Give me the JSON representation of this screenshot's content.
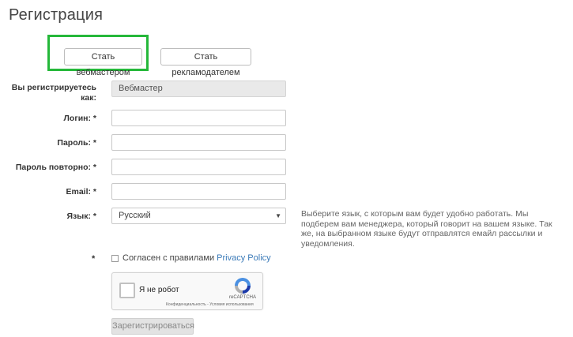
{
  "page": {
    "title": "Регистрация"
  },
  "role_buttons": {
    "webmaster": "Стать вебмастером",
    "advertiser": "Стать рекламодателем"
  },
  "form": {
    "role": {
      "label": "Вы регистрируетесь как:",
      "value": "Вебмастер"
    },
    "login": {
      "label": "Логин: *",
      "value": ""
    },
    "password": {
      "label": "Пароль: *",
      "value": ""
    },
    "password_repeat": {
      "label": "Пароль повторно: *",
      "value": ""
    },
    "email": {
      "label": "Email: *",
      "value": ""
    },
    "language": {
      "label": "Язык: *",
      "value": "Русский",
      "hint": "Выберите язык, с которым вам будет удобно работать. Мы подберем вам менеджера, который говорит на вашем языке. Так же, на выбранном языке будут отправлятся емайл рассылки и уведомления."
    },
    "agree": {
      "star": "*",
      "text": "Согласен с правилами",
      "link": "Privacy Policy",
      "checked": false
    },
    "captcha": {
      "label": "Я не робот",
      "brand": "reCAPTCHA",
      "links": "Конфиденциальность - Условия использования",
      "icon": "recaptcha-logo-icon"
    },
    "submit_label": "Зарегистрироваться"
  },
  "colors": {
    "highlight": "#25b83a",
    "link": "#3a7ab8"
  }
}
